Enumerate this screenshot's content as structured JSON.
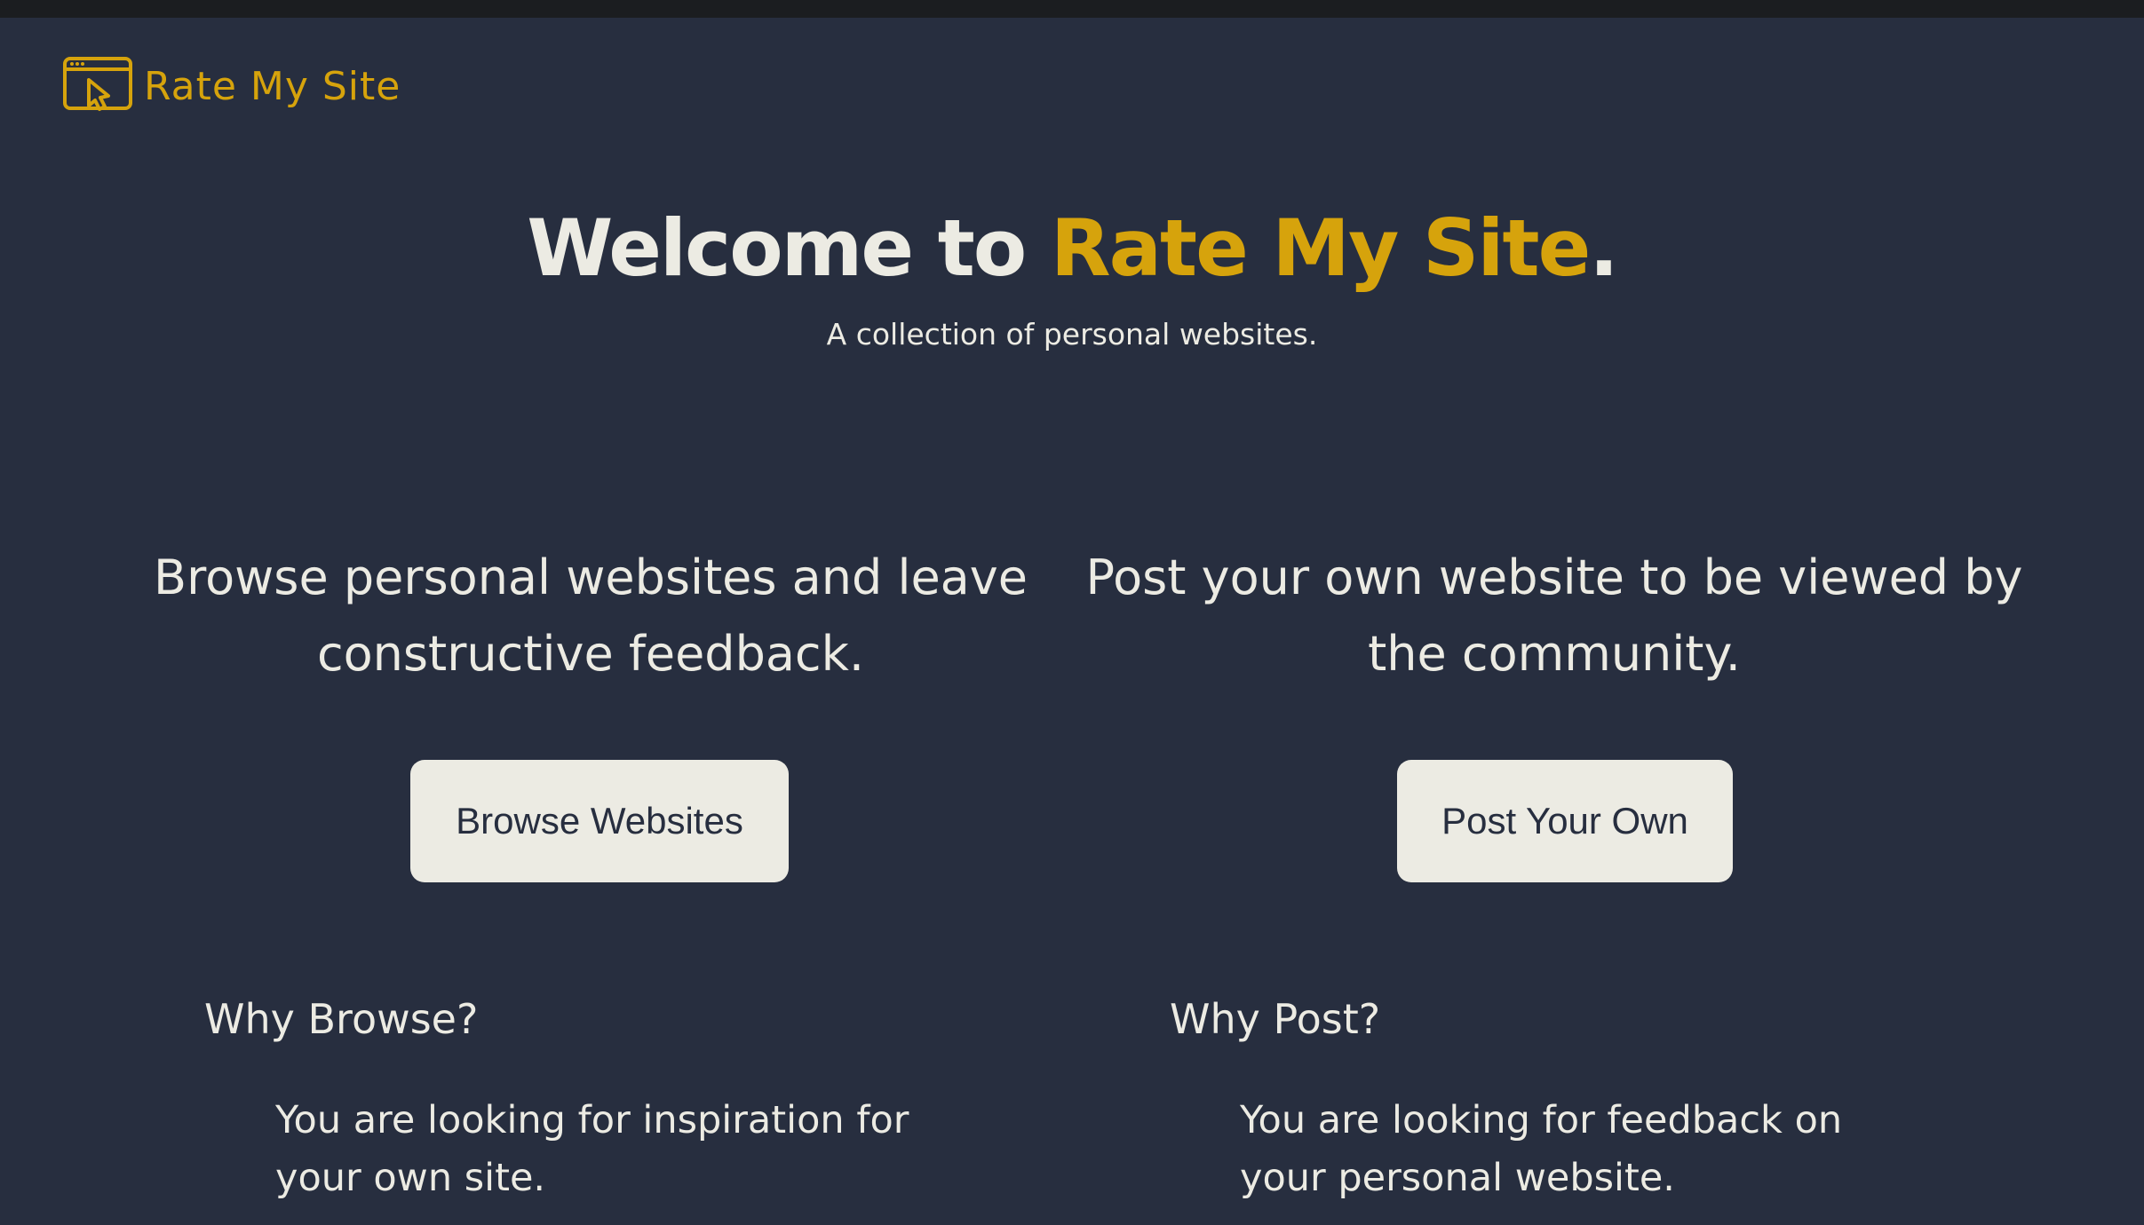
{
  "brand": {
    "name": "Rate My Site",
    "logo_icon": "browser-cursor-icon",
    "accent_color": "#d6a30c"
  },
  "hero": {
    "title_prefix": "Welcome to ",
    "title_accent": "Rate My Site",
    "title_suffix": ".",
    "subtitle": "A collection of personal websites."
  },
  "features": {
    "browse": {
      "description": "Browse personal websites and leave constructive feedback.",
      "button_label": "Browse Websites",
      "why_heading": "Why Browse?",
      "why_text": "You are looking for inspiration for your own site."
    },
    "post": {
      "description": "Post your own website to be viewed by the community.",
      "button_label": "Post Your Own",
      "why_heading": "Why Post?",
      "why_text": "You are looking for feedback on your personal website."
    }
  },
  "colors": {
    "background": "#272e3f",
    "text": "#ecebe3",
    "button_bg": "#ecebe3",
    "button_text": "#272e3f"
  }
}
